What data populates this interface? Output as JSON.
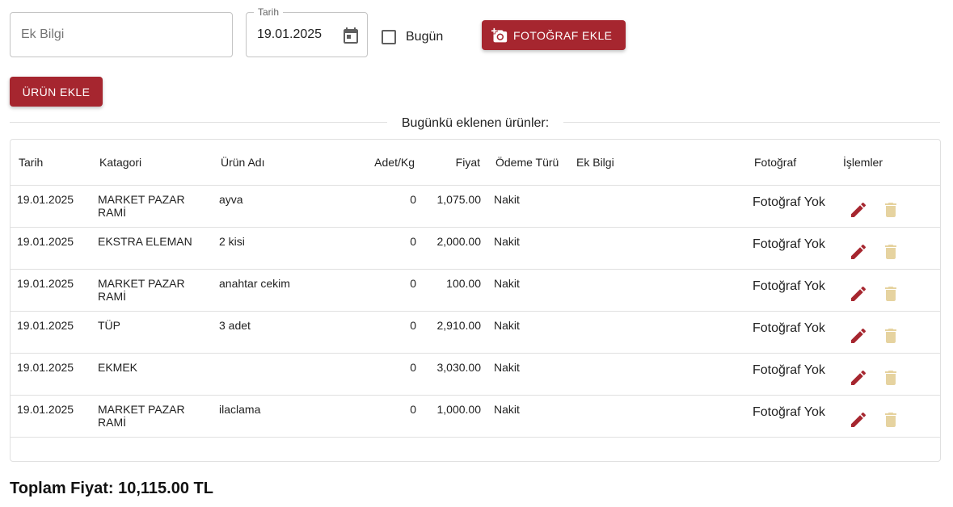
{
  "form": {
    "extra_info_placeholder": "Ek Bilgi",
    "date_label": "Tarih",
    "date_value": "19.01.2025",
    "today_label": "Bugün",
    "today_checked": false,
    "photo_button": "FOTOĞRAF EKLE",
    "add_button": "ÜRÜN EKLE"
  },
  "section_title": "Bugünkü eklenen ürünler:",
  "table": {
    "headers": [
      "Tarih",
      "Katagori",
      "Ürün Adı",
      "Adet/Kg",
      "Fiyat",
      "Ödeme Türü",
      "Ek Bilgi",
      "Fotoğraf",
      "İşlemler"
    ],
    "rows": [
      {
        "date": "19.01.2025",
        "category": "MARKET PAZAR RAMİ",
        "name": "ayva",
        "qty": "0",
        "price": "1,075.00",
        "payment": "Nakit",
        "extra": "",
        "photo": "Fotoğraf Yok"
      },
      {
        "date": "19.01.2025",
        "category": "EKSTRA ELEMAN",
        "name": "2 kisi",
        "qty": "0",
        "price": "2,000.00",
        "payment": "Nakit",
        "extra": "",
        "photo": "Fotoğraf Yok"
      },
      {
        "date": "19.01.2025",
        "category": "MARKET PAZAR RAMİ",
        "name": "anahtar cekim",
        "qty": "0",
        "price": "100.00",
        "payment": "Nakit",
        "extra": "",
        "photo": "Fotoğraf Yok"
      },
      {
        "date": "19.01.2025",
        "category": "TÜP",
        "name": "3 adet",
        "qty": "0",
        "price": "2,910.00",
        "payment": "Nakit",
        "extra": "",
        "photo": "Fotoğraf Yok"
      },
      {
        "date": "19.01.2025",
        "category": "EKMEK",
        "name": "",
        "qty": "0",
        "price": "3,030.00",
        "payment": "Nakit",
        "extra": "",
        "photo": "Fotoğraf Yok"
      },
      {
        "date": "19.01.2025",
        "category": "MARKET PAZAR RAMİ",
        "name": "ilaclama",
        "qty": "0",
        "price": "1,000.00",
        "payment": "Nakit",
        "extra": "",
        "photo": "Fotoğraf Yok"
      }
    ]
  },
  "total_text": "Toplam Fiyat: 10,115.00 TL",
  "icons": {
    "date": "calendar-icon",
    "photo": "add-photo-camera-icon",
    "edit": "pencil-icon",
    "delete": "trash-icon"
  },
  "colors": {
    "primary": "#a6262f",
    "edit_icon": "#a6262f",
    "delete_icon_disabled": "#e6d3a0",
    "border": "#e0e0e0"
  }
}
